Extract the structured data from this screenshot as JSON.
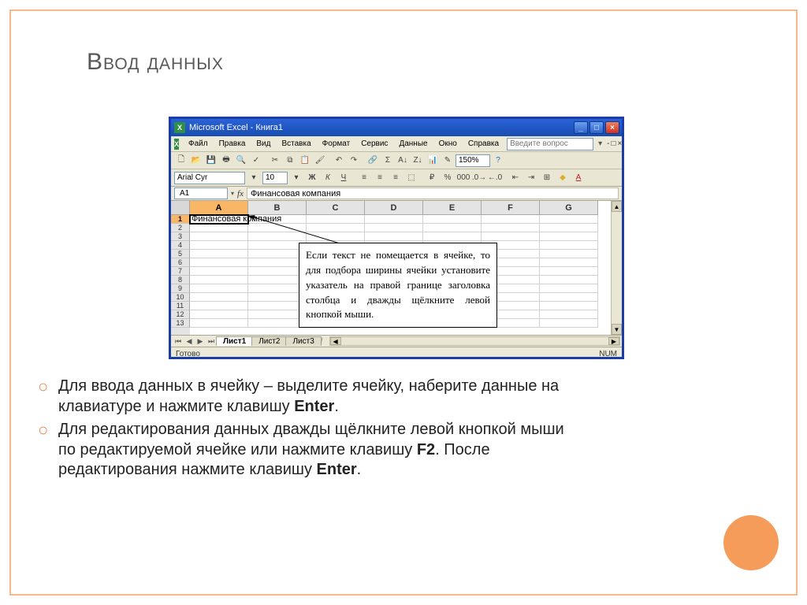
{
  "slide": {
    "title": "Ввод данных"
  },
  "excel": {
    "titlebar": {
      "app": "Microsoft Excel",
      "doc": "Книга1"
    },
    "menus": [
      "Файл",
      "Правка",
      "Вид",
      "Вставка",
      "Формат",
      "Сервис",
      "Данные",
      "Окно",
      "Справка"
    ],
    "help_placeholder": "Введите вопрос",
    "zoom": "150%",
    "font_name": "Arial Cyr",
    "font_size": "10",
    "name_box": "A1",
    "formula_label": "fx",
    "formula_value": "Финансовая компания",
    "columns": [
      "A",
      "B",
      "C",
      "D",
      "E",
      "F",
      "G"
    ],
    "rows": [
      "1",
      "2",
      "3",
      "4",
      "5",
      "6",
      "7",
      "8",
      "9",
      "10",
      "11",
      "12",
      "13"
    ],
    "active_cell_value": "Финансовая компания",
    "sheets": [
      "Лист1",
      "Лист2",
      "Лист3"
    ],
    "status_ready": "Готово",
    "status_num": "NUM"
  },
  "callout": {
    "text": "Если текст не помещается в ячейке, то для подбора ширины ячейки установите указатель на правой границе заголовка столбца и дважды щёлкните левой кнопкой мыши."
  },
  "bullets": {
    "b1_pre": "Для ввода данных в ячейку – выделите ячейку, наберите данные на клавиатуре и нажмите клавишу ",
    "b1_k1": "Enter",
    "b1_post": ".",
    "b2_pre": "Для редактирования данных дважды щёлкните левой кнопкой мыши по редактируемой ячейке или нажмите клавишу ",
    "b2_k1": "F2",
    "b2_mid": ". После редактирования нажмите клавишу ",
    "b2_k2": "Enter",
    "b2_post": "."
  }
}
